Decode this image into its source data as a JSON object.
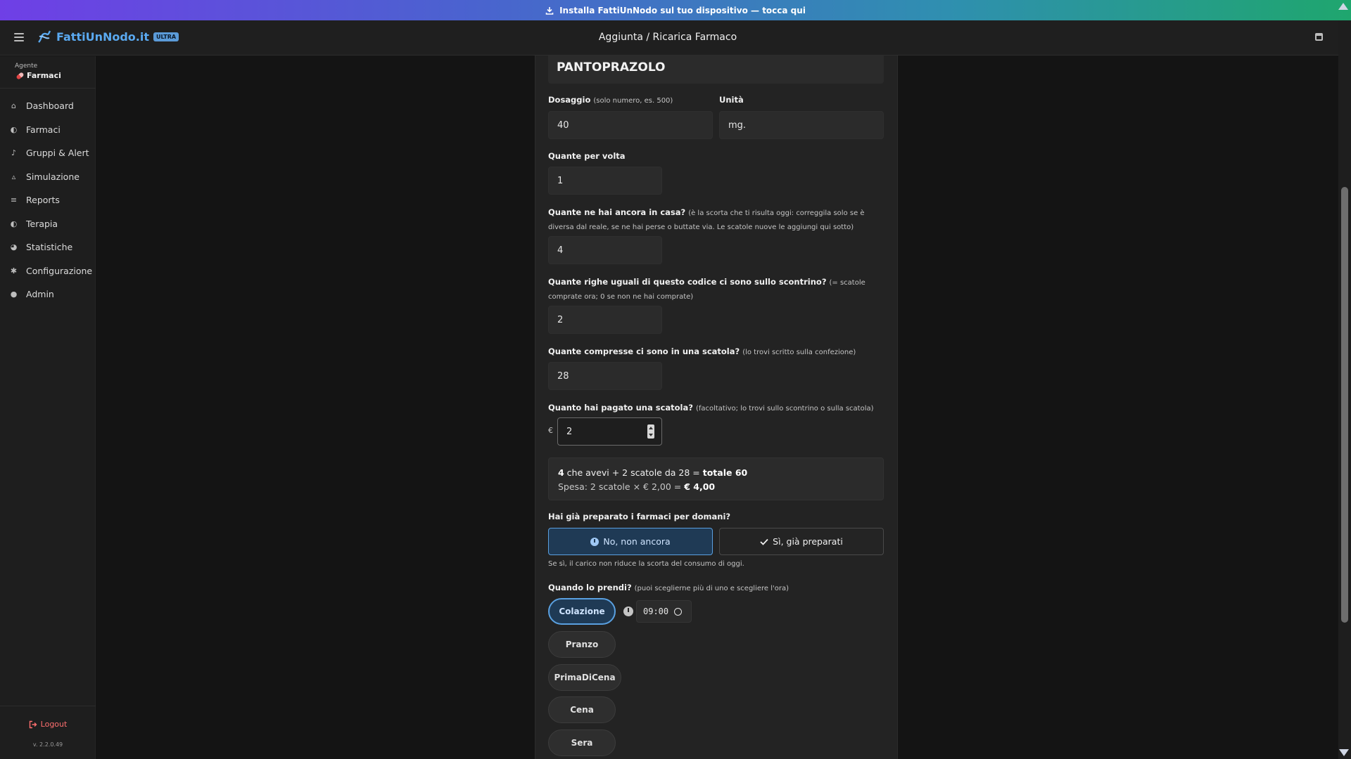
{
  "banner": {
    "text": "Installa FattiUnNodo sul tuo dispositivo — tocca qui",
    "icon": "download-icon"
  },
  "header": {
    "brand": "FattiUnNodo.it",
    "badge": "ULTRA",
    "title": "Aggiunta / Ricarica Farmaco",
    "calendar_icon": "calendar-icon"
  },
  "sidebar": {
    "agent_label": "Agente",
    "agent_name": "Farmaci",
    "items": [
      {
        "label": "Dashboard",
        "icon": "home-icon"
      },
      {
        "label": "Farmaci",
        "icon": "pills-icon"
      },
      {
        "label": "Gruppi & Alert",
        "icon": "bell-icon"
      },
      {
        "label": "Simulazione",
        "icon": "flask-icon"
      },
      {
        "label": "Reports",
        "icon": "chart-icon"
      },
      {
        "label": "Terapia",
        "icon": "pills-icon"
      },
      {
        "label": "Statistiche",
        "icon": "pie-chart-icon"
      },
      {
        "label": "Configurazione",
        "icon": "gear-icon"
      },
      {
        "label": "Admin",
        "icon": "users-icon"
      }
    ],
    "logout": "Logout",
    "version": "v. 2.2.0.49"
  },
  "form": {
    "drug_name": "PANTOPRAZOLO",
    "dosage": {
      "label": "Dosaggio",
      "hint": "(solo numero, es. 500)",
      "value": "40"
    },
    "unit": {
      "label": "Unità",
      "value": "mg."
    },
    "per_dose": {
      "label": "Quante per volta",
      "value": "1"
    },
    "at_home": {
      "label": "Quante ne hai ancora in casa?",
      "hint": "(è la scorta che ti risulta oggi: correggila solo se è diversa dal reale, se ne hai perse o buttate via. Le scatole nuove le aggiungi qui sotto)",
      "value": "4"
    },
    "receipt_rows": {
      "label": "Quante righe uguali di questo codice ci sono sullo scontrino?",
      "hint": "(= scatole comprate ora; 0 se non ne hai comprate)",
      "value": "2"
    },
    "per_box": {
      "label": "Quante compresse ci sono in una scatola?",
      "hint": "(lo trovi scritto sulla confezione)",
      "value": "28"
    },
    "price": {
      "label": "Quanto hai pagato una scatola?",
      "hint": "(facoltativo; lo trovi sullo scontrino o sulla scatola)",
      "currency": "€",
      "value": "2"
    },
    "summary": {
      "had": "4",
      "middle": " che avevi + 2 scatole da 28 = ",
      "total": "totale 60",
      "spend": "Spesa: 2 scatole × € 2,00 = ",
      "spend_total": "€ 4,00"
    },
    "prepared": {
      "label": "Hai già preparato i farmaci per domani?",
      "no": "No, non ancora",
      "yes": "Sì, già preparati",
      "selected": "no",
      "note": "Se sì, il carico non riduce la scorta del consumo di oggi."
    },
    "when": {
      "label": "Quando lo prendi?",
      "hint": "(puoi sceglierne più di uno e scegliere l'ora)",
      "meals": [
        "Colazione",
        "Pranzo",
        "PrimaDiCena",
        "Cena",
        "Sera"
      ],
      "active": "Colazione",
      "time": "09:00"
    }
  },
  "colors": {
    "accent": "#5aa0e0",
    "brand": "#5aa9f0",
    "logout": "#ff6f6f"
  }
}
